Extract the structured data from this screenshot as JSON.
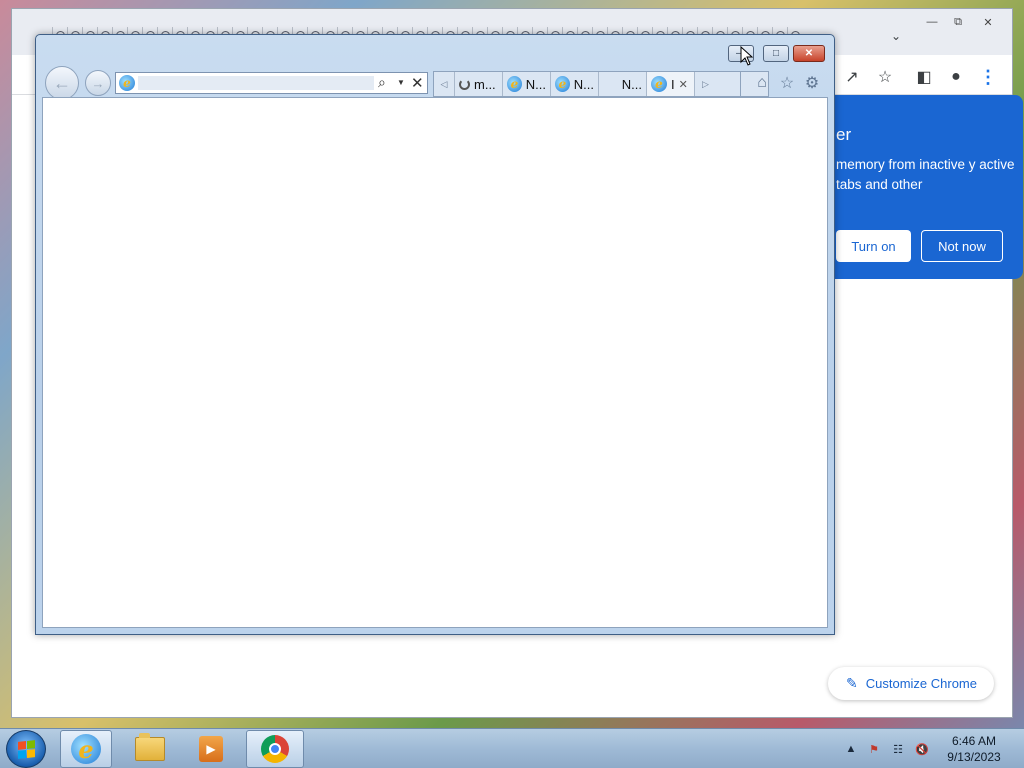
{
  "chrome": {
    "tab_list_icon": "chevron-down-icon",
    "toolbar_icons": [
      "share-icon",
      "star-icon",
      "sidebar-icon",
      "profile-icon",
      "more-menu-icon"
    ],
    "popup": {
      "title": "er",
      "text": "memory from inactive y active tabs and other",
      "turn_on_label": "Turn on",
      "not_now_label": "Not now",
      "background_color": "#1a66d2"
    },
    "customize_label": "Customize Chrome"
  },
  "ie": {
    "address": {
      "value": "",
      "placeholder": ""
    },
    "tabs": [
      {
        "label": "m...",
        "icon": "loading-icon"
      },
      {
        "label": "N...",
        "icon": "ie-icon"
      },
      {
        "label": "N...",
        "icon": "ie-icon"
      },
      {
        "label": "N...",
        "icon": ""
      },
      {
        "label": "I",
        "icon": "ie-icon",
        "active": true
      }
    ],
    "toolbar_icons": [
      "home-icon",
      "favorites-icon",
      "tools-icon"
    ]
  },
  "taskbar": {
    "apps": [
      "internet-explorer",
      "windows-explorer",
      "windows-media-player",
      "google-chrome"
    ],
    "clock": {
      "time": "6:46 AM",
      "date": "9/13/2023"
    },
    "tray_icons": [
      "show-hidden-icons",
      "action-center-icon",
      "network-icon",
      "volume-muted-icon"
    ]
  }
}
